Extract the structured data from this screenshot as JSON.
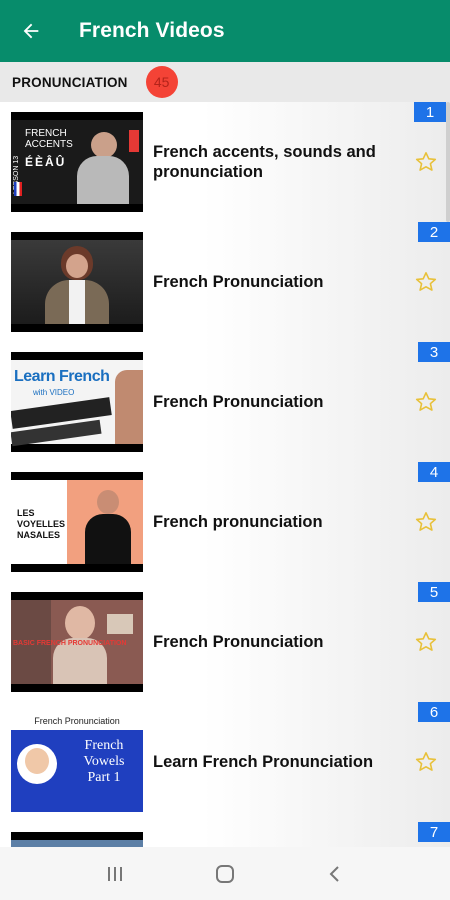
{
  "header": {
    "title": "French Videos",
    "back_icon": "arrow-left-icon"
  },
  "section": {
    "label": "PRONUNCIATION",
    "count": "45"
  },
  "videos": [
    {
      "number": "1",
      "title": "French accents, sounds and pronunciation",
      "thumb_text": [
        "FRENCH",
        "ACCENTS",
        "ÉÈÂÛ"
      ],
      "thumb_side": "LESSON 13"
    },
    {
      "number": "2",
      "title": "French Pronunciation"
    },
    {
      "number": "3",
      "title": "French Pronunciation",
      "thumb_text": [
        "Learn French",
        "with VIDEO"
      ]
    },
    {
      "number": "4",
      "title": "French pronunciation",
      "thumb_text": [
        "LES",
        "VOYELLES",
        "NASALES"
      ]
    },
    {
      "number": "5",
      "title": "French Pronunciation",
      "thumb_text": [
        "BASIC FRENCH PRONUNCIATION"
      ]
    },
    {
      "number": "6",
      "title": "Learn French Pronunciation",
      "thumb_text": [
        "French Pronunciation",
        "French",
        "Vowels",
        "Part 1"
      ]
    },
    {
      "number": "7",
      "title": ""
    }
  ],
  "navbar": {
    "icons": [
      "recent-apps-icon",
      "home-icon",
      "back-icon"
    ]
  },
  "colors": {
    "appbar": "#078c6b",
    "badge_red": "#f44336",
    "badge_blue": "#1e73e8",
    "star": "#e8c13a"
  }
}
